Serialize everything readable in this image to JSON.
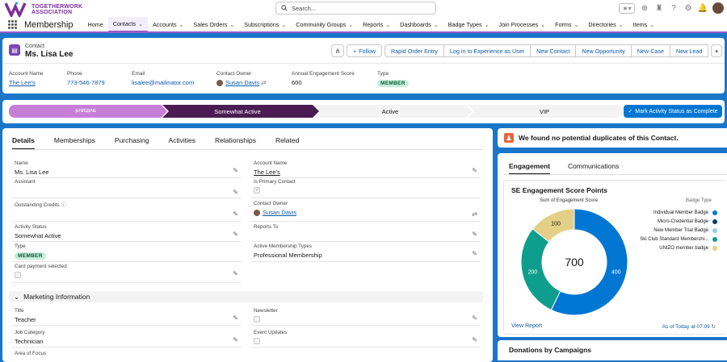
{
  "brand": {
    "name_line1": "TOGETHERWORK",
    "name_line2": "ASSOCIATION"
  },
  "search": {
    "placeholder": "Search..."
  },
  "app": {
    "name": "Membership"
  },
  "nav": [
    {
      "label": "Home",
      "chev": false
    },
    {
      "label": "Contacts",
      "chev": true,
      "active": true
    },
    {
      "label": "Accounts",
      "chev": true
    },
    {
      "label": "Sales Orders",
      "chev": true
    },
    {
      "label": "Subscriptions",
      "chev": true
    },
    {
      "label": "Community Groups",
      "chev": true
    },
    {
      "label": "Reports",
      "chev": true
    },
    {
      "label": "Dashboards",
      "chev": true
    },
    {
      "label": "Badge Types",
      "chev": true
    },
    {
      "label": "Join Processes",
      "chev": true
    },
    {
      "label": "Forms",
      "chev": true
    },
    {
      "label": "Directories",
      "chev": true
    },
    {
      "label": "Items",
      "chev": true
    }
  ],
  "record": {
    "type": "Contact",
    "name": "Ms. Lisa Lee"
  },
  "actions": [
    "Follow",
    "Rapid Order Entry",
    "Log in to Experience as User",
    "New Contact",
    "New Opportunity",
    "New Case",
    "New Lead"
  ],
  "highlights": {
    "account_name_label": "Account Name",
    "account_name": "The Lee's",
    "phone_label": "Phone",
    "phone": "773-546-7879",
    "email_label": "Email",
    "email": "lisalee@mailinator.com",
    "owner_label": "Contact Owner",
    "owner": "Susan Davis",
    "score_label": "Annual Engagement Score",
    "score": "600",
    "type_label": "Type",
    "type": "MEMBER"
  },
  "path": {
    "stages": [
      "Inactive",
      "Somewhat Active",
      "Active",
      "VIP"
    ],
    "current": 1,
    "mark_button": "Mark Activity Status as Complete"
  },
  "detail_tabs": [
    "Details",
    "Memberships",
    "Purchasing",
    "Activities",
    "Relationships",
    "Related"
  ],
  "fields": {
    "name_label": "Name",
    "name": "Ms. Lisa Lee",
    "account_label": "Account Name",
    "account": "The Lee's",
    "assistant_label": "Assistant",
    "primary_label": "Is Primary Contact",
    "credits_label": "Outstanding Credits",
    "owner_label": "Contact Owner",
    "owner": "Susan Davis",
    "activity_label": "Activity Status",
    "activity": "Somewhat Active",
    "reports_label": "Reports To",
    "type_label": "Type",
    "type": "MEMBER",
    "active_memb_label": "Active Membership Types",
    "active_memb": "Professional Membership",
    "card_label": "Card payment selected"
  },
  "marketing": {
    "section": "Marketing Information",
    "title_label": "Title",
    "title": "Teacher",
    "newsletter_label": "Newsletter",
    "job_label": "Job Category",
    "job": "Technician",
    "event_label": "Event Updates",
    "focus_label": "Area of Focus"
  },
  "duplicates": {
    "text": "We found no potential duplicates of this Contact."
  },
  "right_tabs": [
    "Engagement",
    "Communications"
  ],
  "engagement": {
    "title": "SE Engagement Score Points",
    "subtitle": "Sum of Engagement Score",
    "legend_title": "Badge Type",
    "total": "700",
    "view_report": "View Report",
    "as_of": "As of Today at 07:09"
  },
  "chart_data": {
    "type": "pie",
    "title": "SE Engagement Score Points",
    "categories": [
      "Individual Member Badge",
      "Micro-Credential Badge",
      "New Member Trial Badge",
      "Ski Club Standard Membershi...",
      "UNIZO member badge"
    ],
    "values": [
      400,
      0,
      0,
      200,
      100
    ],
    "colors": [
      "#0176d3",
      "#0c3d6e",
      "#90d0ea",
      "#0e9e8e",
      "#e4cf86"
    ],
    "total": 700,
    "legend_position": "right"
  },
  "donations": {
    "title": "Donations by Campaigns"
  },
  "colors": {
    "accent": "#9a5cc6",
    "path_done": "#c67fd7",
    "path_current": "#4a1c52",
    "brand_blue": "#0176d3"
  }
}
